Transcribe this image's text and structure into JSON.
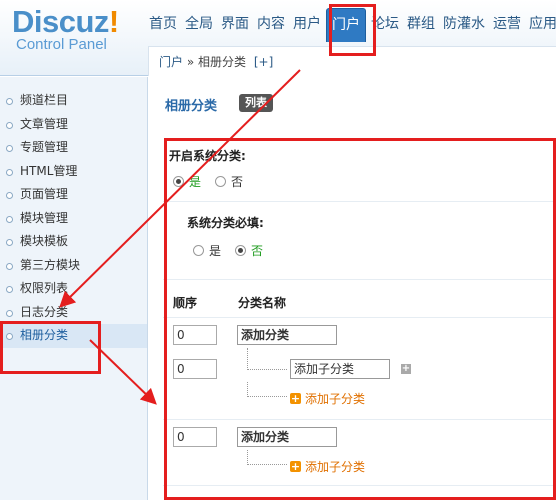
{
  "logo": {
    "main": "Discuz",
    "bang": "!",
    "sub": "Control Panel"
  },
  "nav": {
    "items": [
      "首页",
      "全局",
      "界面",
      "内容",
      "用户",
      "门户",
      "论坛",
      "群组",
      "防灌水",
      "运营",
      "应用"
    ],
    "active": "门户"
  },
  "breadcrumb": {
    "section": "门户",
    "separator": "»",
    "current": "相册分类",
    "add": "[+]"
  },
  "sidebar": {
    "items": [
      "频道栏目",
      "文章管理",
      "专题管理",
      "HTML管理",
      "页面管理",
      "模块管理",
      "模块模板",
      "第三方模块",
      "权限列表",
      "日志分类",
      "相册分类"
    ],
    "active": "相册分类"
  },
  "main": {
    "title": "相册分类",
    "tab": "列表",
    "enable_question": "开启系统分类:",
    "enable_options": [
      "是",
      "否"
    ],
    "enable_selected": "是",
    "required_question": "系统分类必填:",
    "required_options": [
      "是",
      "否"
    ],
    "required_selected": "否",
    "columns": {
      "order": "顺序",
      "name": "分类名称"
    },
    "rows": [
      {
        "order": "0",
        "name": "添加分类",
        "child": "添加子分类",
        "add_child": "添加子分类"
      },
      {
        "order": "0",
        "name": "添加分类",
        "add_child": "添加子分类"
      }
    ]
  },
  "colors": {
    "annotation": "#e41e1e",
    "accent": "#2f7ac3",
    "orange": "#f39200"
  }
}
